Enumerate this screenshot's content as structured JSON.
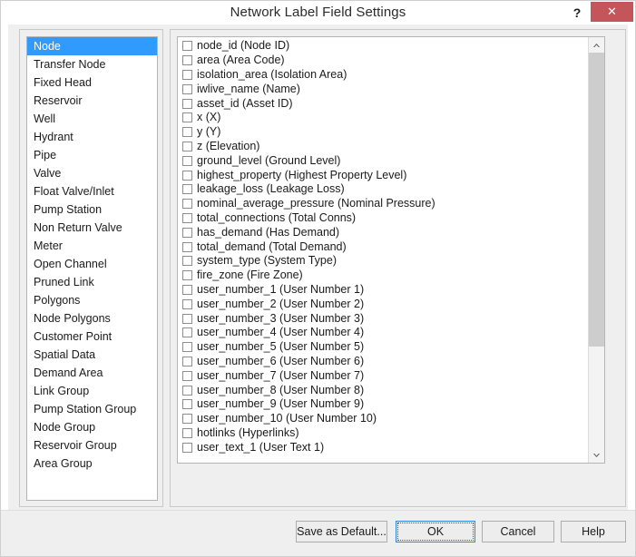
{
  "window": {
    "title": "Network Label Field Settings",
    "help_icon": "question-mark-icon",
    "help_label": "?",
    "close_icon": "close-x-icon",
    "close_label": "✕",
    "accent_selection_color": "#2f9bff",
    "close_button_color": "#c4565b",
    "focus_border_color": "#2f86e0"
  },
  "object_type_list": {
    "selected": "Node",
    "items": [
      {
        "label": "Node"
      },
      {
        "label": "Transfer Node"
      },
      {
        "label": "Fixed Head"
      },
      {
        "label": "Reservoir"
      },
      {
        "label": "Well"
      },
      {
        "label": "Hydrant"
      },
      {
        "label": "Pipe"
      },
      {
        "label": "Valve"
      },
      {
        "label": "Float Valve/Inlet"
      },
      {
        "label": "Pump Station"
      },
      {
        "label": "Non Return Valve"
      },
      {
        "label": "Meter"
      },
      {
        "label": "Open Channel"
      },
      {
        "label": "Pruned Link"
      },
      {
        "label": "Polygons"
      },
      {
        "label": "Node Polygons"
      },
      {
        "label": "Customer Point"
      },
      {
        "label": "Spatial Data"
      },
      {
        "label": "Demand Area"
      },
      {
        "label": "Link Group"
      },
      {
        "label": "Pump Station Group"
      },
      {
        "label": "Node Group"
      },
      {
        "label": "Reservoir Group"
      },
      {
        "label": "Area Group"
      }
    ]
  },
  "field_list": {
    "items": [
      {
        "label": "node_id (Node ID)",
        "checked": false
      },
      {
        "label": "area (Area Code)",
        "checked": false
      },
      {
        "label": "isolation_area (Isolation Area)",
        "checked": false
      },
      {
        "label": "iwlive_name (Name)",
        "checked": false
      },
      {
        "label": "asset_id (Asset ID)",
        "checked": false
      },
      {
        "label": "x (X)",
        "checked": false
      },
      {
        "label": "y (Y)",
        "checked": false
      },
      {
        "label": "z (Elevation)",
        "checked": false
      },
      {
        "label": "ground_level (Ground Level)",
        "checked": false
      },
      {
        "label": "highest_property (Highest Property Level)",
        "checked": false
      },
      {
        "label": "leakage_loss (Leakage Loss)",
        "checked": false
      },
      {
        "label": "nominal_average_pressure (Nominal Pressure)",
        "checked": false
      },
      {
        "label": "total_connections (Total Conns)",
        "checked": false
      },
      {
        "label": "has_demand (Has Demand)",
        "checked": false
      },
      {
        "label": "total_demand (Total Demand)",
        "checked": false
      },
      {
        "label": "system_type (System Type)",
        "checked": false
      },
      {
        "label": "fire_zone (Fire Zone)",
        "checked": false
      },
      {
        "label": "user_number_1 (User Number 1)",
        "checked": false
      },
      {
        "label": "user_number_2 (User Number 2)",
        "checked": false
      },
      {
        "label": "user_number_3 (User Number 3)",
        "checked": false
      },
      {
        "label": "user_number_4 (User Number 4)",
        "checked": false
      },
      {
        "label": "user_number_5 (User Number 5)",
        "checked": false
      },
      {
        "label": "user_number_6 (User Number 6)",
        "checked": false
      },
      {
        "label": "user_number_7 (User Number 7)",
        "checked": false
      },
      {
        "label": "user_number_8 (User Number 8)",
        "checked": false
      },
      {
        "label": "user_number_9 (User Number 9)",
        "checked": false
      },
      {
        "label": "user_number_10 (User Number 10)",
        "checked": false
      },
      {
        "label": "hotlinks (Hyperlinks)",
        "checked": false
      },
      {
        "label": "user_text_1 (User Text 1)",
        "checked": false
      }
    ],
    "scroll": {
      "up_arrow_icon": "chevron-up-icon",
      "down_arrow_icon": "chevron-down-icon",
      "thumb_top_percent": 0,
      "thumb_height_percent": 74.5
    }
  },
  "footer": {
    "save_as_default_label": "Save as Default...",
    "ok_label": "OK",
    "cancel_label": "Cancel",
    "help_label": "Help"
  }
}
